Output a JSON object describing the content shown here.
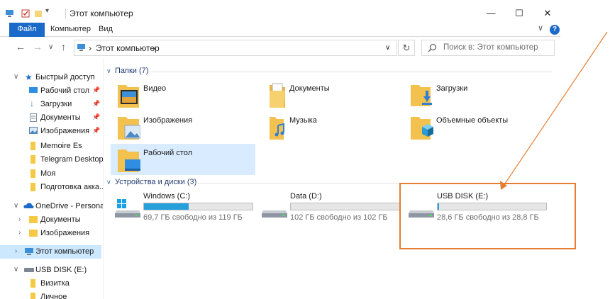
{
  "window": {
    "title": "Этот компьютер",
    "minimize": "—",
    "maximize": "☐",
    "close": "✕"
  },
  "ribbon": {
    "tabs": [
      "Файл",
      "Компьютер",
      "Вид"
    ]
  },
  "address": {
    "back": "←",
    "forward": "→",
    "history": "∨",
    "up": "↑",
    "crumb_sep": "›",
    "location": "Этот компьютер",
    "trailing": "›",
    "dropdown": "∨",
    "refresh": "↻"
  },
  "search": {
    "placeholder": "Поиск в: Этот компьютер"
  },
  "sidebar": {
    "quick_access": "Быстрый доступ",
    "quick_items": [
      {
        "label": "Рабочий стол",
        "pinned": true
      },
      {
        "label": "Загрузки",
        "pinned": true
      },
      {
        "label": "Документы",
        "pinned": true
      },
      {
        "label": "Изображения",
        "pinned": true
      },
      {
        "label": "Memoire Es",
        "pinned": false
      },
      {
        "label": "Telegram Desktop",
        "pinned": false
      },
      {
        "label": "Моя",
        "pinned": false
      },
      {
        "label": "Подготовка акка...",
        "pinned": false
      }
    ],
    "onedrive": "OneDrive - Personal",
    "onedrive_items": [
      "Документы",
      "Изображения"
    ],
    "this_pc": "Этот компьютер",
    "usb": "USB DISK (E:)",
    "usb_items": [
      "Визитка",
      "Личное"
    ]
  },
  "folders": {
    "header": "Папки (7)",
    "items": [
      {
        "label": "Видео",
        "icon": "video-folder-icon"
      },
      {
        "label": "Документы",
        "icon": "documents-folder-icon"
      },
      {
        "label": "Загрузки",
        "icon": "downloads-folder-icon"
      },
      {
        "label": "Изображения",
        "icon": "pictures-folder-icon"
      },
      {
        "label": "Музыка",
        "icon": "music-folder-icon"
      },
      {
        "label": "Объемные объекты",
        "icon": "3d-objects-folder-icon"
      },
      {
        "label": "Рабочий стол",
        "icon": "desktop-folder-icon"
      }
    ]
  },
  "devices": {
    "header": "Устройства и диски (3)",
    "items": [
      {
        "name": "Windows (C:)",
        "free": "69,7 ГБ свободно из 119 ГБ",
        "used_fraction": 0.41
      },
      {
        "name": "Data (D:)",
        "free": "102 ГБ свободно из 102 ГБ",
        "used_fraction": 0.0
      },
      {
        "name": "USB DISK (E:)",
        "free": "28,6 ГБ свободно из 28,8 ГБ",
        "used_fraction": 0.01
      }
    ]
  },
  "colors": {
    "accent": "#1b6ac9",
    "bar_fill": "#26a0da",
    "highlight": "#e67e32"
  }
}
